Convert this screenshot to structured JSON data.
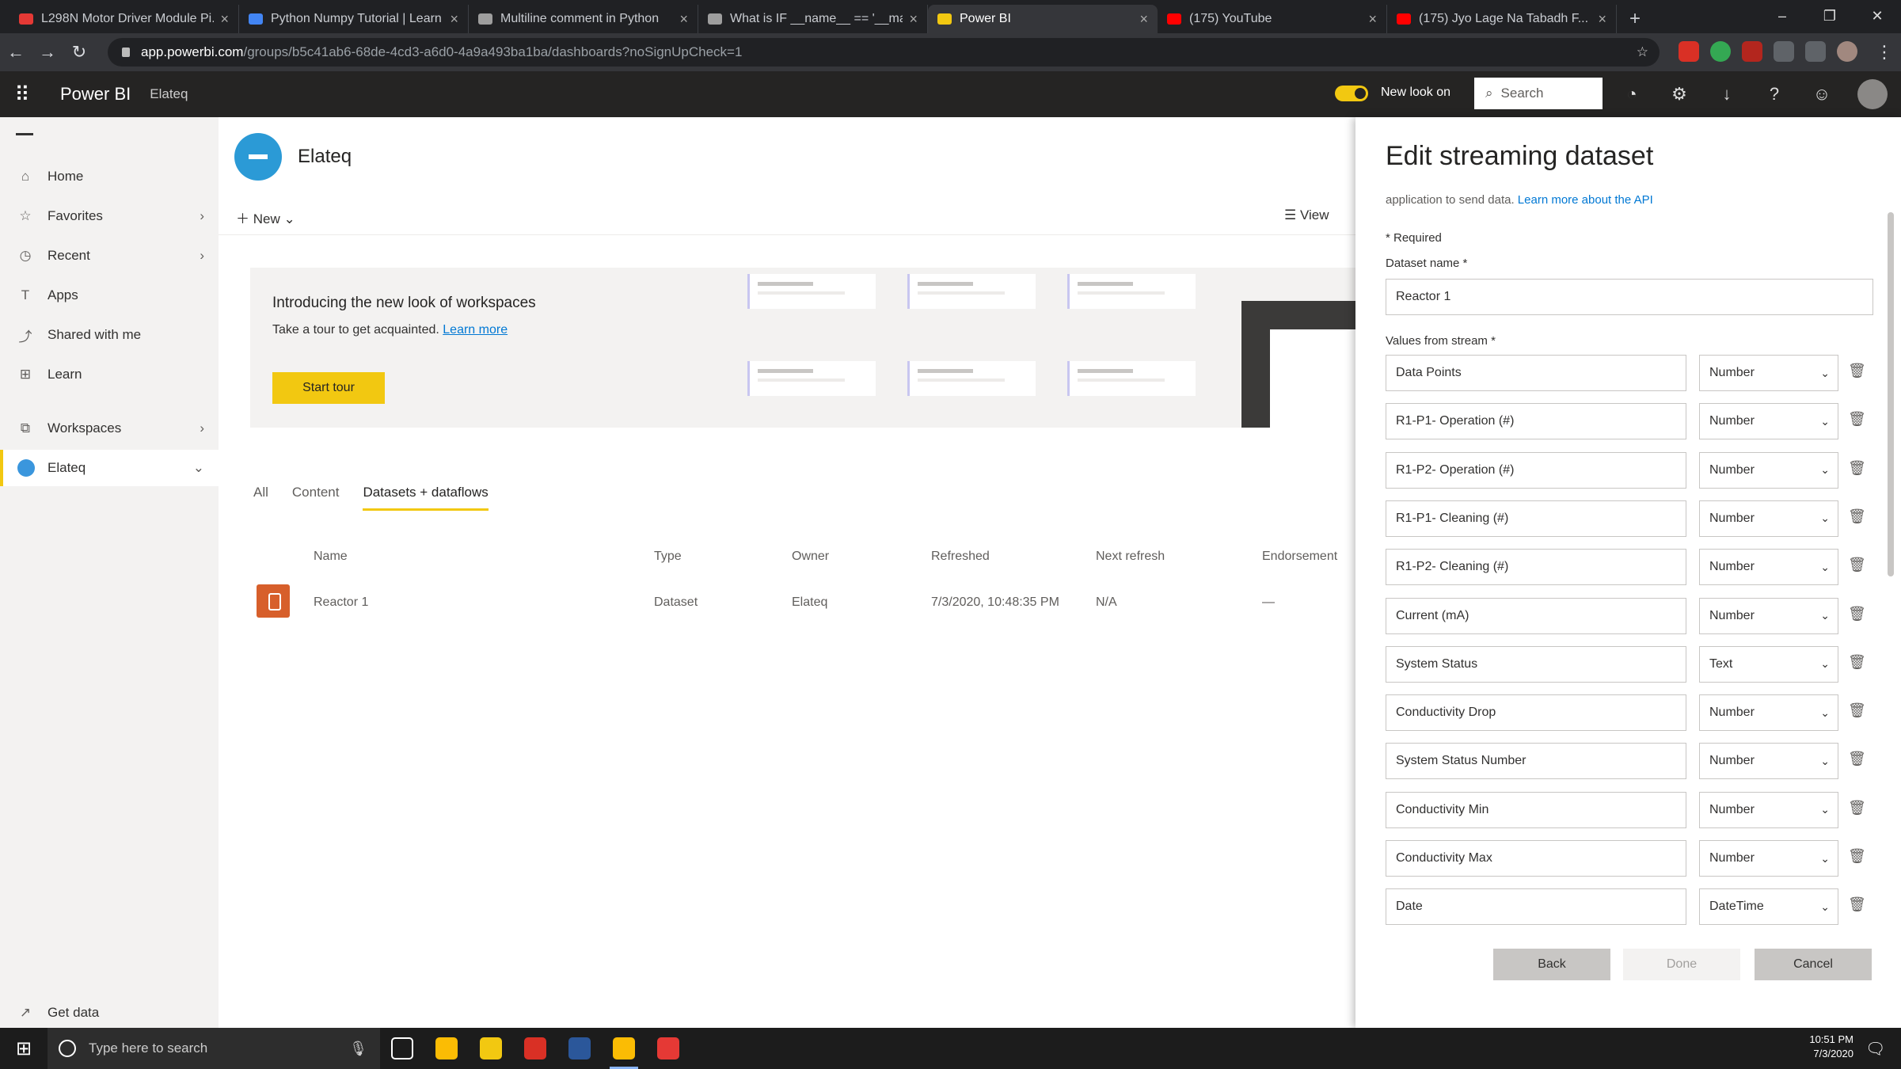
{
  "browser": {
    "tabs": [
      {
        "title": "L298N Motor Driver Module Pi...",
        "icon_color": "#e53935"
      },
      {
        "title": "Python Numpy Tutorial | Learn N...",
        "icon_color": "#4285f4"
      },
      {
        "title": "Multiline comment in Python",
        "icon_color": "#9e9e9e"
      },
      {
        "title": "What is IF __name__ == '__main...",
        "icon_color": "#9e9e9e"
      },
      {
        "title": "Power BI",
        "icon_color": "#f2c811",
        "active": true
      },
      {
        "title": "(175) YouTube",
        "icon_color": "#ff0000"
      },
      {
        "title": "(175) Jyo Lage Na Tabadh F...",
        "icon_color": "#ff0000"
      }
    ],
    "new_tab_icon": "plus-icon",
    "url_host": "app.powerbi.com",
    "url_path": "/groups/b5c41ab6-68de-4cd3-a6d0-4a9a493ba1ba/dashboards?noSignUpCheck=1"
  },
  "powerbi": {
    "brand": "Power BI",
    "workspace_crumb": "Elateq",
    "new_look": "New look on",
    "search_placeholder": "Search"
  },
  "nav": {
    "items": [
      {
        "label": "Home",
        "icon": "home-icon",
        "glyph": "⌂"
      },
      {
        "label": "Favorites",
        "icon": "star-icon",
        "glyph": "☆",
        "chevron": true
      },
      {
        "label": "Recent",
        "icon": "clock-icon",
        "glyph": "◷",
        "chevron": true
      },
      {
        "label": "Apps",
        "icon": "apps-icon",
        "glyph": "T"
      },
      {
        "label": "Shared with me",
        "icon": "share-icon",
        "glyph": "⤴"
      },
      {
        "label": "Learn",
        "icon": "book-icon",
        "glyph": "⊞"
      },
      {
        "label": "Workspaces",
        "icon": "workspaces-icon",
        "glyph": "⧉",
        "chevron": true
      },
      {
        "label": "Elateq",
        "icon": "workspace-icon",
        "glyph": "",
        "chevron": true,
        "selected": true
      }
    ],
    "get_data": "Get data"
  },
  "workspace": {
    "title": "Elateq",
    "new_label": "New",
    "view_label": "View",
    "banner_title": "Introducing the new look of workspaces",
    "banner_sub": "Take a tour to get acquainted.",
    "learn_more": "Learn more",
    "start_tour": "Start tour",
    "tabs": [
      "All",
      "Content",
      "Datasets + dataflows"
    ],
    "columns": [
      "Name",
      "Type",
      "Owner",
      "Refreshed",
      "Next refresh",
      "Endorsement"
    ],
    "row": {
      "name": "Reactor 1",
      "type": "Dataset",
      "owner": "Elateq",
      "refreshed": "7/3/2020, 10:48:35 PM",
      "next_refresh": "N/A",
      "endorsement": "—"
    }
  },
  "panel": {
    "title": "Edit streaming dataset",
    "intro": "application to send data.",
    "intro_link": "Learn more about the API",
    "required": "* Required",
    "dataset_name_label": "Dataset name *",
    "dataset_name": "Reactor 1",
    "values_label": "Values from stream *",
    "fields": [
      {
        "name": "Data Points",
        "type": "Number"
      },
      {
        "name": "R1-P1- Operation (#)",
        "type": "Number"
      },
      {
        "name": "R1-P2- Operation (#)",
        "type": "Number"
      },
      {
        "name": "R1-P1- Cleaning (#)",
        "type": "Number"
      },
      {
        "name": "R1-P2- Cleaning (#)",
        "type": "Number"
      },
      {
        "name": "Current (mA)",
        "type": "Number"
      },
      {
        "name": "System Status",
        "type": "Text"
      },
      {
        "name": "Conductivity Drop",
        "type": "Number"
      },
      {
        "name": "System Status Number",
        "type": "Number"
      },
      {
        "name": "Conductivity Min",
        "type": "Number"
      },
      {
        "name": "Conductivity Max",
        "type": "Number"
      },
      {
        "name": "Date",
        "type": "DateTime"
      }
    ],
    "back": "Back",
    "done": "Done",
    "cancel": "Cancel"
  },
  "taskbar": {
    "search_placeholder": "Type here to search",
    "time": "10:51 PM",
    "date": "7/3/2020",
    "apps": [
      {
        "name": "task-view-icon",
        "color": "#1c1c1c"
      },
      {
        "name": "chrome-icon",
        "color": "#fbbc04"
      },
      {
        "name": "file-explorer-icon",
        "color": "#f2c811"
      },
      {
        "name": "acrobat-icon",
        "color": "#d93025"
      },
      {
        "name": "word-icon",
        "color": "#2b579a"
      },
      {
        "name": "chrome-active-icon",
        "color": "#fbbc04",
        "active": true
      },
      {
        "name": "paint-icon",
        "color": "#e53935"
      }
    ]
  }
}
